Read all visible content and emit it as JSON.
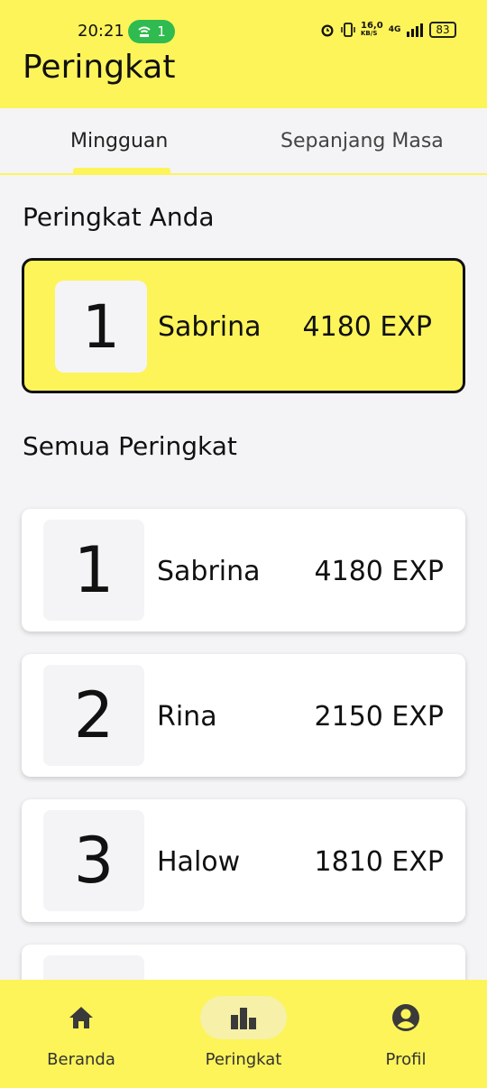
{
  "status": {
    "time": "20:21",
    "hotspot_count": "1",
    "net_speed_top": "16,0",
    "net_speed_unit": "KB/S",
    "network": "4G",
    "battery": "83"
  },
  "header": {
    "title": "Peringkat"
  },
  "tabs": [
    {
      "label": "Mingguan",
      "active": true
    },
    {
      "label": "Sepanjang Masa",
      "active": false
    }
  ],
  "my_rank": {
    "section_title": "Peringkat Anda",
    "rank": "1",
    "name": "Sabrina",
    "exp": "4180 EXP"
  },
  "all_ranks": {
    "section_title": "Semua Peringkat",
    "items": [
      {
        "rank": "1",
        "name": "Sabrina",
        "exp": "4180 EXP"
      },
      {
        "rank": "2",
        "name": "Rina",
        "exp": "2150 EXP"
      },
      {
        "rank": "3",
        "name": "Halow",
        "exp": "1810 EXP"
      },
      {
        "rank": "",
        "name": "",
        "exp": ""
      }
    ]
  },
  "bottom_nav": [
    {
      "label": "Beranda",
      "icon": "home-icon"
    },
    {
      "label": "Peringkat",
      "icon": "leaderboard-icon",
      "active": true
    },
    {
      "label": "Profil",
      "icon": "profile-icon"
    }
  ],
  "colors": {
    "accent": "#fdf45a",
    "background": "#f4f4f6",
    "card": "#ffffff"
  }
}
